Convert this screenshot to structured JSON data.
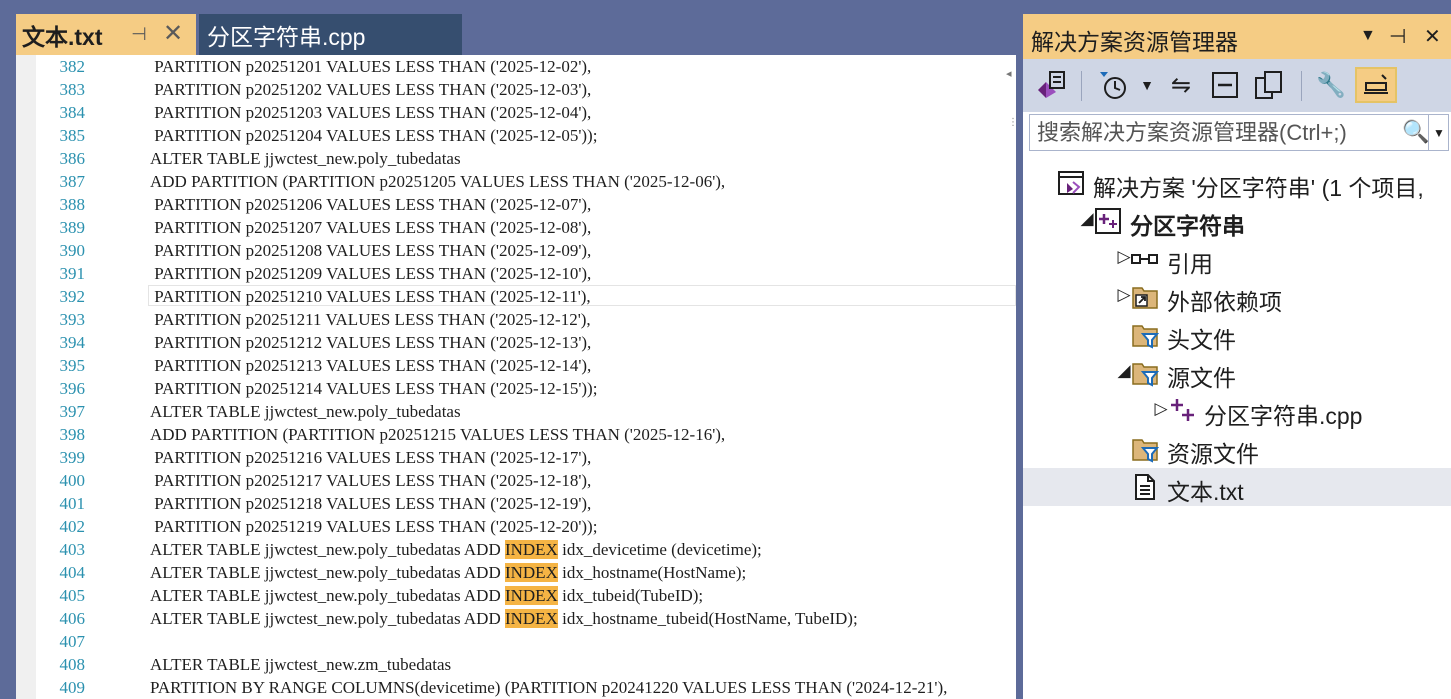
{
  "editor": {
    "tabs": [
      {
        "label": "文本.txt",
        "active": true
      },
      {
        "label": "分区字符串.cpp",
        "active": false
      }
    ],
    "current_line": "392",
    "lines": [
      {
        "no": "382",
        "pre": " PARTITION p20251201 VALUES LESS THAN ('2025-12-02'),"
      },
      {
        "no": "383",
        "pre": " PARTITION p20251202 VALUES LESS THAN ('2025-12-03'),"
      },
      {
        "no": "384",
        "pre": " PARTITION p20251203 VALUES LESS THAN ('2025-12-04'),"
      },
      {
        "no": "385",
        "pre": " PARTITION p20251204 VALUES LESS THAN ('2025-12-05'));"
      },
      {
        "no": "386",
        "pre": "ALTER TABLE jjwctest_new.poly_tubedatas"
      },
      {
        "no": "387",
        "pre": "ADD PARTITION (PARTITION p20251205 VALUES LESS THAN ('2025-12-06'),"
      },
      {
        "no": "388",
        "pre": " PARTITION p20251206 VALUES LESS THAN ('2025-12-07'),"
      },
      {
        "no": "389",
        "pre": " PARTITION p20251207 VALUES LESS THAN ('2025-12-08'),"
      },
      {
        "no": "390",
        "pre": " PARTITION p20251208 VALUES LESS THAN ('2025-12-09'),"
      },
      {
        "no": "391",
        "pre": " PARTITION p20251209 VALUES LESS THAN ('2025-12-10'),"
      },
      {
        "no": "392",
        "pre": " PARTITION p20251210 VALUES LESS THAN ('2025-12-11'),"
      },
      {
        "no": "393",
        "pre": " PARTITION p20251211 VALUES LESS THAN ('2025-12-12'),"
      },
      {
        "no": "394",
        "pre": " PARTITION p20251212 VALUES LESS THAN ('2025-12-13'),"
      },
      {
        "no": "395",
        "pre": " PARTITION p20251213 VALUES LESS THAN ('2025-12-14'),"
      },
      {
        "no": "396",
        "pre": " PARTITION p20251214 VALUES LESS THAN ('2025-12-15'));"
      },
      {
        "no": "397",
        "pre": "ALTER TABLE jjwctest_new.poly_tubedatas"
      },
      {
        "no": "398",
        "pre": "ADD PARTITION (PARTITION p20251215 VALUES LESS THAN ('2025-12-16'),"
      },
      {
        "no": "399",
        "pre": " PARTITION p20251216 VALUES LESS THAN ('2025-12-17'),"
      },
      {
        "no": "400",
        "pre": " PARTITION p20251217 VALUES LESS THAN ('2025-12-18'),"
      },
      {
        "no": "401",
        "pre": " PARTITION p20251218 VALUES LESS THAN ('2025-12-19'),"
      },
      {
        "no": "402",
        "pre": " PARTITION p20251219 VALUES LESS THAN ('2025-12-20'));"
      },
      {
        "no": "403",
        "pre": "ALTER TABLE jjwctest_new.poly_tubedatas ADD ",
        "hl": "INDEX",
        "post": " idx_devicetime (devicetime);"
      },
      {
        "no": "404",
        "pre": "ALTER TABLE jjwctest_new.poly_tubedatas ADD ",
        "hl": "INDEX",
        "post": " idx_hostname(HostName);"
      },
      {
        "no": "405",
        "pre": "ALTER TABLE jjwctest_new.poly_tubedatas ADD ",
        "hl": "INDEX",
        "post": " idx_tubeid(TubeID);"
      },
      {
        "no": "406",
        "pre": "ALTER TABLE jjwctest_new.poly_tubedatas ADD ",
        "hl": "INDEX",
        "post": " idx_hostname_tubeid(HostName, TubeID);"
      },
      {
        "no": "407",
        "pre": ""
      },
      {
        "no": "408",
        "pre": "ALTER TABLE jjwctest_new.zm_tubedatas"
      },
      {
        "no": "409",
        "pre": "PARTITION BY RANGE COLUMNS(devicetime) (PARTITION p20241220 VALUES LESS THAN ('2024-12-21'),"
      }
    ]
  },
  "explorer": {
    "title": "解决方案资源管理器",
    "search_placeholder": "搜索解决方案资源管理器(Ctrl+;)",
    "tree": [
      {
        "label": "解决方案 '分区字符串' (1 个项目,",
        "icon": "solution-icon",
        "twisty": "none",
        "indent": 0
      },
      {
        "label": "分区字符串",
        "icon": "cpp-project-icon",
        "twisty": "expanded",
        "indent": 1,
        "bold": true
      },
      {
        "label": "引用",
        "icon": "references-icon",
        "twisty": "collapsed",
        "indent": 2
      },
      {
        "label": "外部依赖项",
        "icon": "external-deps-icon",
        "twisty": "collapsed",
        "indent": 2
      },
      {
        "label": "头文件",
        "icon": "filter-folder-icon",
        "twisty": "none",
        "indent": 2
      },
      {
        "label": "源文件",
        "icon": "filter-folder-icon",
        "twisty": "expanded",
        "indent": 2
      },
      {
        "label": "分区字符串.cpp",
        "icon": "cpp-file-icon",
        "twisty": "collapsed",
        "indent": 3
      },
      {
        "label": "资源文件",
        "icon": "filter-folder-icon",
        "twisty": "none",
        "indent": 2
      },
      {
        "label": "文本.txt",
        "icon": "text-file-icon",
        "twisty": "none",
        "indent": 2,
        "selected": true
      }
    ]
  },
  "colors": {
    "chrome": "#5d6b99",
    "active_tab": "#f5cc84",
    "inactive_tab": "#364e6f",
    "line_number": "#2b91af",
    "highlight": "#f5b444",
    "toolbar": "#cfd6e5",
    "vs_purple": "#68217a"
  }
}
